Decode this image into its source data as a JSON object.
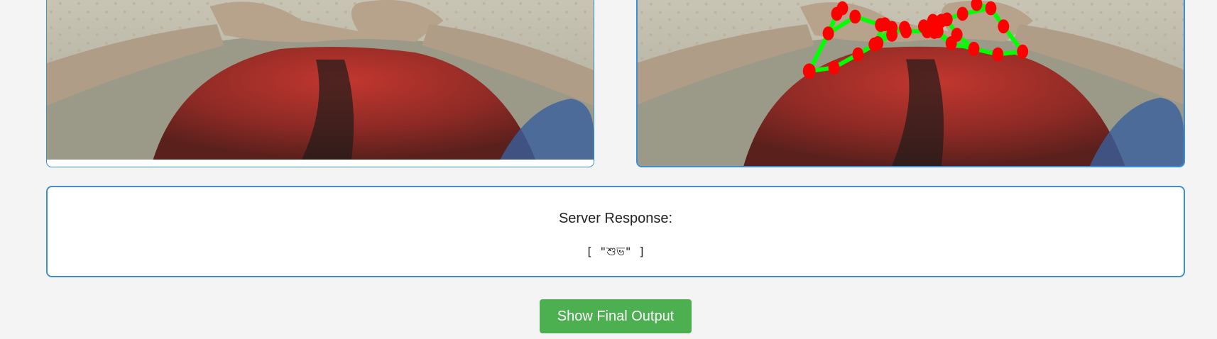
{
  "camera_feed": {
    "label": ""
  },
  "processed_feed": {
    "label": ""
  },
  "server_response": {
    "title": "Server Response:",
    "value": "[ \"শুভ\" ]"
  },
  "actions": {
    "final_output_label": "Show Final Output"
  },
  "colors": {
    "accent_border": "#3a8fd8",
    "button_green": "#4caf50",
    "landmark_point": "#ff0000",
    "landmark_line": "#00ff00",
    "page_background": "#f4f4f4"
  }
}
